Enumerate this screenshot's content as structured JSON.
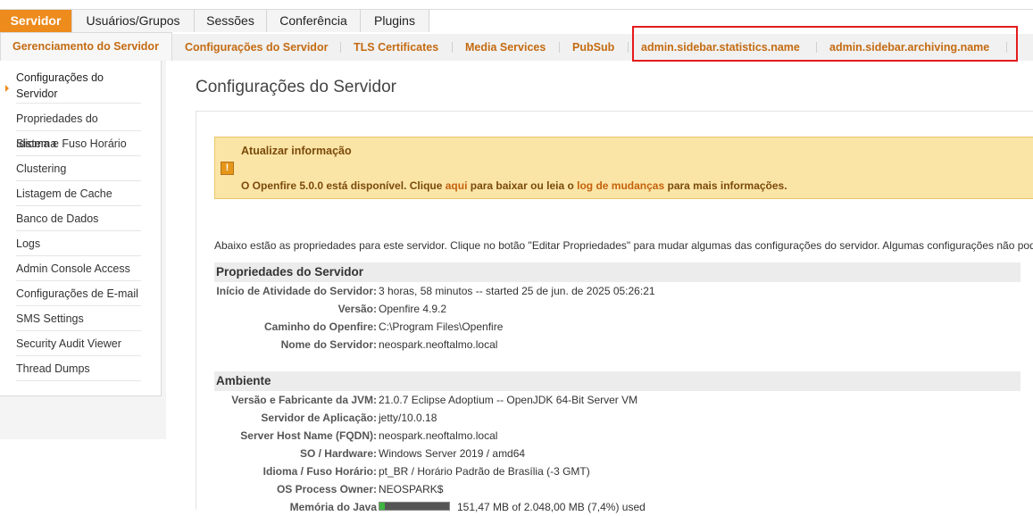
{
  "main_tabs": [
    {
      "label": "Servidor",
      "active": true
    },
    {
      "label": "Usuários/Grupos",
      "active": false
    },
    {
      "label": "Sessões",
      "active": false
    },
    {
      "label": "Conferência",
      "active": false
    },
    {
      "label": "Plugins",
      "active": false
    }
  ],
  "sub_tabs": [
    {
      "label": "Gerenciamento do Servidor",
      "active": true
    },
    {
      "label": "Configurações do Servidor"
    },
    {
      "label": "TLS Certificates"
    },
    {
      "label": "Media Services"
    },
    {
      "label": "PubSub"
    },
    {
      "label": "admin.sidebar.statistics.name"
    },
    {
      "label": "admin.sidebar.archiving.name"
    }
  ],
  "sidebar": {
    "items": [
      {
        "label": "Configurações do Servidor",
        "active": true
      },
      {
        "label": "Propriedades do Sistema"
      },
      {
        "label": "Idioma e Fuso Horário"
      },
      {
        "label": "Clustering"
      },
      {
        "label": "Listagem de Cache"
      },
      {
        "label": "Banco de Dados"
      },
      {
        "label": "Logs"
      },
      {
        "label": "Admin Console Access"
      },
      {
        "label": "Configurações de E-mail"
      },
      {
        "label": "SMS Settings"
      },
      {
        "label": "Security Audit Viewer"
      },
      {
        "label": "Thread Dumps"
      }
    ]
  },
  "page": {
    "title": "Configurações do Servidor",
    "alert": {
      "title": "Atualizar informação",
      "msg_pre": "O Openfire 5.0.0 está disponível. Clique ",
      "link1": "aqui",
      "msg_mid": " para baixar ou leia o ",
      "link2": "log de mudanças",
      "msg_post": " para mais informações.",
      "icon": "warning-icon",
      "icon_glyph": "!"
    },
    "intro": "Abaixo estão as propriedades para este servidor. Clique no botão \"Editar Propriedades\" para mudar algumas das configurações do servidor. Algumas configurações não podem ser alteradas."
  },
  "server_props": {
    "title": "Propriedades do Servidor",
    "rows": [
      {
        "label": "Início de Atividade do Servidor:",
        "value": "3 horas, 58 minutos -- started 25 de jun. de 2025 05:26:21"
      },
      {
        "label": "Versão:",
        "value": "Openfire 4.9.2"
      },
      {
        "label": "Caminho do Openfire:",
        "value": "C:\\Program Files\\Openfire"
      },
      {
        "label": "Nome do Servidor:",
        "value": "neospark.neoftalmo.local"
      }
    ]
  },
  "environment": {
    "title": "Ambiente",
    "rows": [
      {
        "label": "Versão e Fabricante da JVM:",
        "value": "21.0.7 Eclipse Adoptium -- OpenJDK 64-Bit Server VM"
      },
      {
        "label": "Servidor de Aplicação:",
        "value": "jetty/10.0.18"
      },
      {
        "label": "Server Host Name (FQDN):",
        "value": "neospark.neoftalmo.local"
      },
      {
        "label": "SO / Hardware:",
        "value": "Windows Server 2019 / amd64"
      },
      {
        "label": "Idioma / Fuso Horário:",
        "value": "pt_BR / Horário Padrão de Brasília (-3 GMT)"
      },
      {
        "label": "OS Process Owner:",
        "value": "NEOSPARK$"
      }
    ],
    "memory": {
      "label": "Memória do Java",
      "value": "151,47 MB of 2.048,00 MB (7,4%) used",
      "fraction": 0.074
    }
  }
}
